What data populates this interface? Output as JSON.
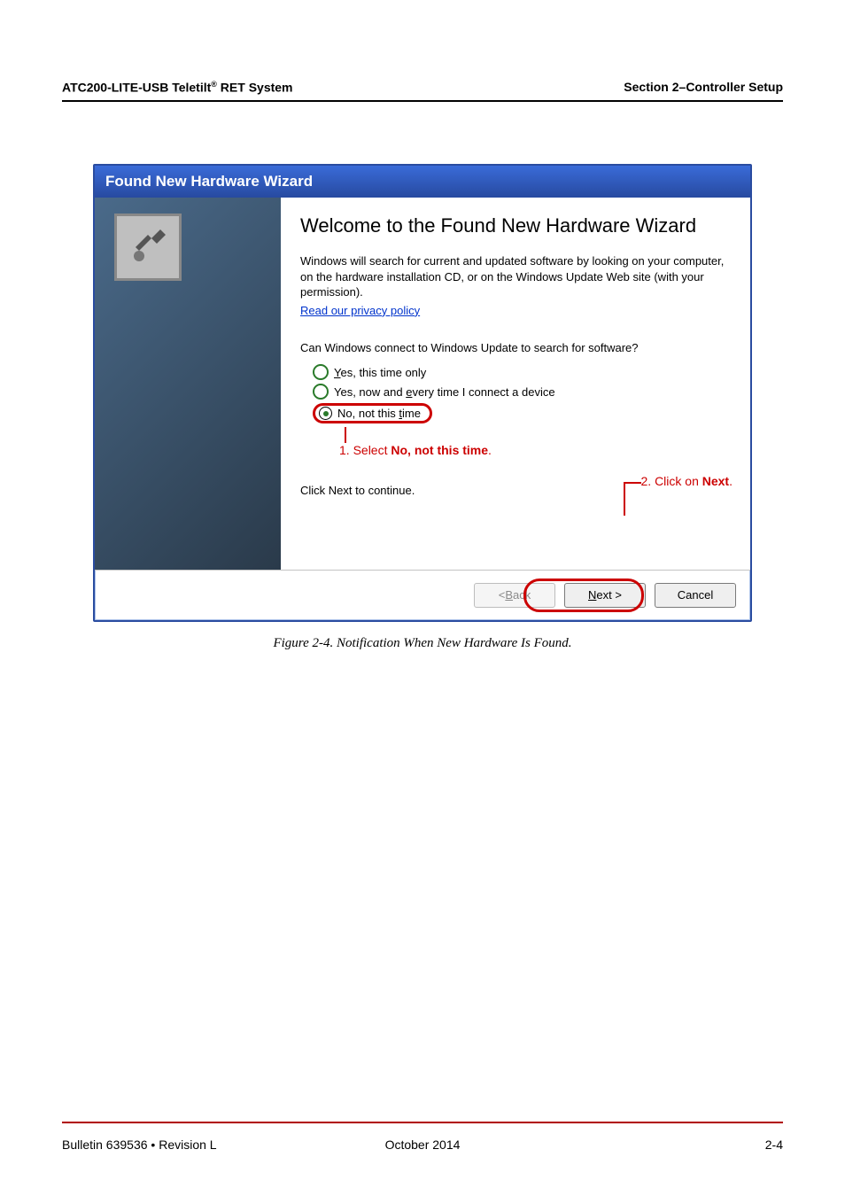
{
  "header": {
    "left_1": "ATC200-LITE-USB Teletilt",
    "left_sup": "®",
    "left_2": " RET System",
    "right": "Section 2–Controller Setup"
  },
  "wizard": {
    "title": "Found New Hardware Wizard",
    "heading": "Welcome to the Found New Hardware Wizard",
    "para": "Windows will search for current and updated software by looking on your computer, on the hardware installation CD, or on the Windows Update Web site (with your permission).",
    "privacy_link": "Read our privacy policy",
    "question": "Can Windows connect to Windows Update to search for software?",
    "radio1_pre": "Y",
    "radio1_rest": "es, this time only",
    "radio2_pre": "Yes, now and ",
    "radio2_u": "e",
    "radio2_rest": "very time I connect a device",
    "radio3_pre": "No, not this ",
    "radio3_u": "t",
    "radio3_rest": "ime",
    "ann1_a": "1. Select ",
    "ann1_b": "No, not this time",
    "ann1_c": ".",
    "click_next": "Click Next to continue.",
    "ann2_a": "2. Click on ",
    "ann2_b": "Next",
    "ann2_c": ".",
    "buttons": {
      "back_lt": "< ",
      "back_u": "B",
      "back_rest": "ack",
      "next_u": "N",
      "next_rest": "ext >",
      "cancel": "Cancel"
    }
  },
  "caption": "Figure 2-4. Notification When New Hardware Is Found.",
  "footer": {
    "left": "Bulletin 639536   •   Revision L",
    "center_a": "October ",
    "center_b": "2014",
    "right": "2-4"
  }
}
